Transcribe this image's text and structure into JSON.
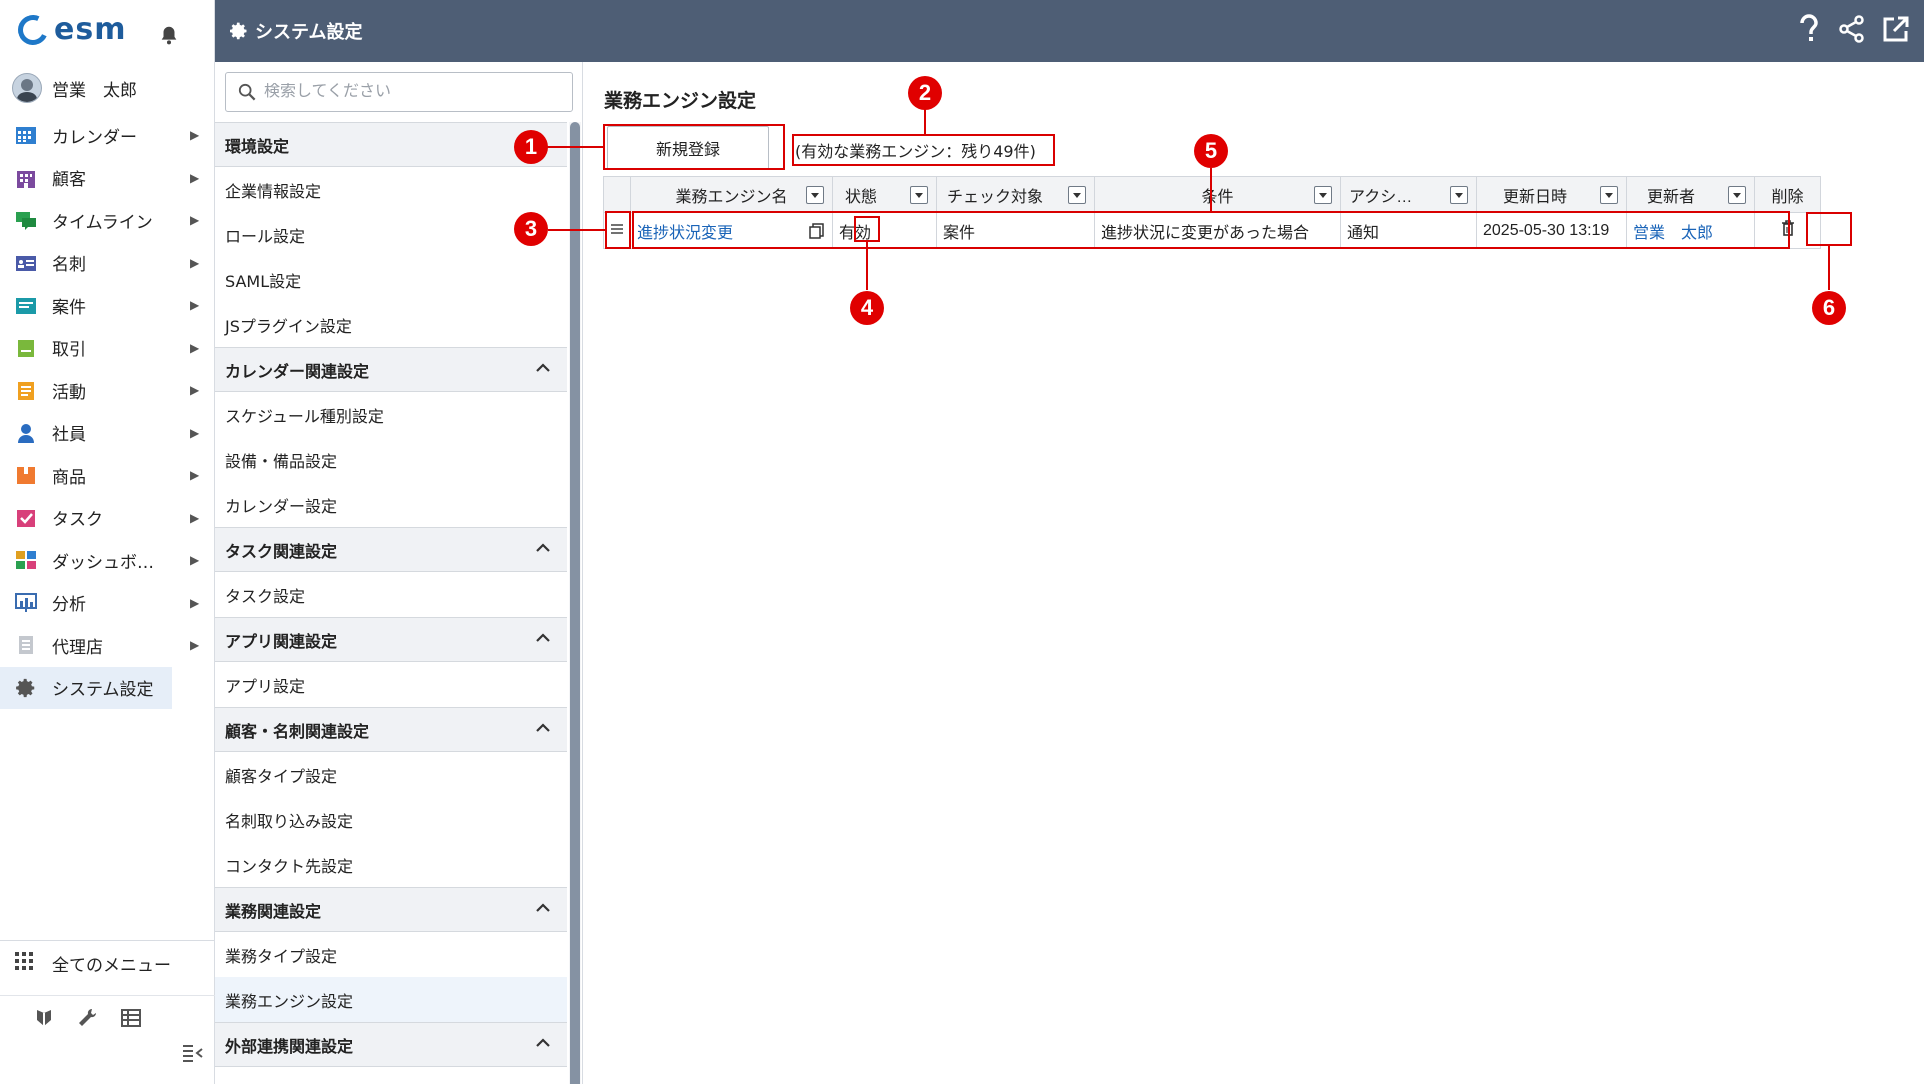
{
  "brand": {
    "name": "esm",
    "color": "#1e5c9c"
  },
  "user": {
    "name": "営業　太郎"
  },
  "nav": {
    "items": [
      {
        "label": "カレンダー",
        "icon": "calendar-icon",
        "color": "#2f7fd0"
      },
      {
        "label": "顧客",
        "icon": "building-icon",
        "color": "#7b4a9e"
      },
      {
        "label": "タイムライン",
        "icon": "chat-icon",
        "color": "#2aa050"
      },
      {
        "label": "名刺",
        "icon": "card-icon",
        "color": "#4a5aa8"
      },
      {
        "label": "案件",
        "icon": "folder-icon",
        "color": "#1b9aa8"
      },
      {
        "label": "取引",
        "icon": "deal-icon",
        "color": "#7ab83c"
      },
      {
        "label": "活動",
        "icon": "note-icon",
        "color": "#f0a020"
      },
      {
        "label": "社員",
        "icon": "person-icon",
        "color": "#2a6cc0"
      },
      {
        "label": "商品",
        "icon": "box-icon",
        "color": "#f07a30"
      },
      {
        "label": "タスク",
        "icon": "check-icon",
        "color": "#d8407a"
      },
      {
        "label": "ダッシュボ…",
        "icon": "dashboard-icon",
        "color": "#e0a020"
      },
      {
        "label": "分析",
        "icon": "chart-icon",
        "color": "#3a6cb0"
      },
      {
        "label": "代理店",
        "icon": "doc-icon",
        "color": "#9aa0a8"
      },
      {
        "label": "システム設定",
        "icon": "gear-icon",
        "color": "#555"
      }
    ],
    "all_menu": "全てのメニュー"
  },
  "header": {
    "title": "システム設定"
  },
  "settings": {
    "search_placeholder": "検索してください",
    "sections": [
      {
        "title": "環境設定",
        "collapsible": false,
        "items": [
          "企業情報設定",
          "ロール設定",
          "SAML設定",
          "JSプラグイン設定"
        ]
      },
      {
        "title": "カレンダー関連設定",
        "collapsible": true,
        "items": [
          "スケジュール種別設定",
          "設備・備品設定",
          "カレンダー設定"
        ]
      },
      {
        "title": "タスク関連設定",
        "collapsible": true,
        "items": [
          "タスク設定"
        ]
      },
      {
        "title": "アプリ関連設定",
        "collapsible": true,
        "items": [
          "アプリ設定"
        ]
      },
      {
        "title": "顧客・名刺関連設定",
        "collapsible": true,
        "items": [
          "顧客タイプ設定",
          "名刺取り込み設定",
          "コンタクト先設定"
        ]
      },
      {
        "title": "業務関連設定",
        "collapsible": true,
        "items": [
          "業務タイプ設定",
          "業務エンジン設定"
        ]
      },
      {
        "title": "外部連携関連設定",
        "collapsible": true,
        "items": []
      }
    ],
    "active_item": "業務エンジン設定"
  },
  "main": {
    "title": "業務エンジン設定",
    "new_button": "新規登録",
    "remaining": "(有効な業務エンジン：残り49件)",
    "table": {
      "columns": [
        "業務エンジン名",
        "状態",
        "チェック対象",
        "条件",
        "アクシ…",
        "更新日時",
        "更新者",
        "削除"
      ],
      "rows": [
        {
          "name": "進捗状況変更",
          "status": "有効",
          "target": "案件",
          "condition": "進捗状況に変更があった場合",
          "action": "通知",
          "updated_at": "2025-05-30 13:19",
          "updated_by": "営業　太郎"
        }
      ]
    }
  },
  "annotations": [
    "1",
    "2",
    "3",
    "4",
    "5",
    "6"
  ],
  "colors": {
    "header_bg": "#4e5e75",
    "annotation": "#d90000",
    "link": "#1a64b8"
  }
}
